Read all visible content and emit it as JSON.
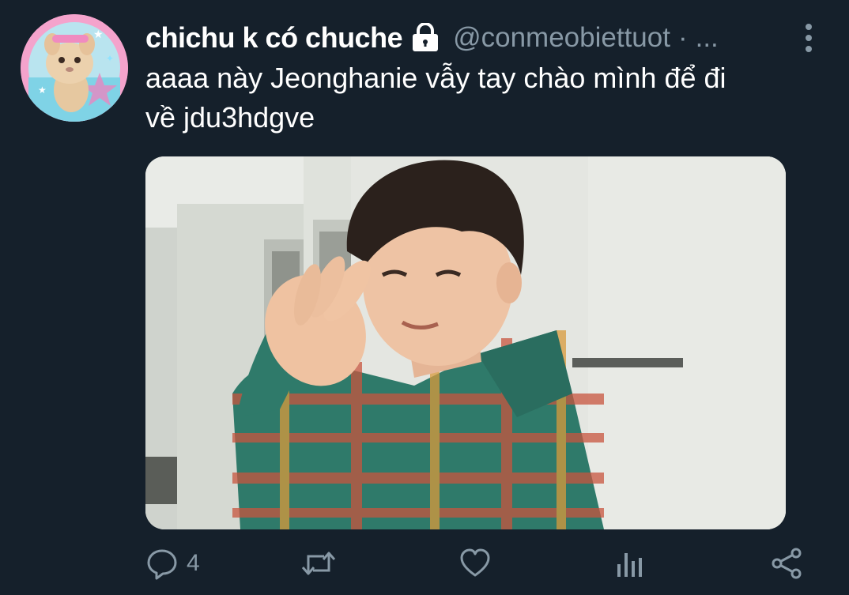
{
  "tweet": {
    "display_name": "chichu k có chuche",
    "handle": "@conmeobiettuot",
    "separator": "·",
    "overflow_text": "...",
    "text_line1": "aaaa này Jeonghanie vẫy tay chào mình để đi",
    "text_line2": "về jdu3hdgve",
    "protected": true
  },
  "actions": {
    "reply_count": "4",
    "icons": [
      "reply-icon",
      "retweet-icon",
      "like-icon",
      "analytics-icon",
      "share-icon"
    ]
  },
  "colors": {
    "background": "#15202b",
    "text_primary": "#ffffff",
    "text_secondary": "#8899a6",
    "avatar_ring": "#f7a6cf"
  }
}
